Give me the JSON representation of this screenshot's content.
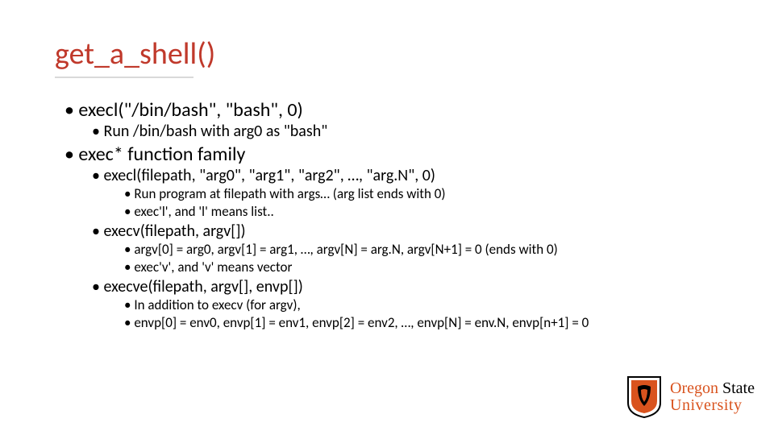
{
  "title": "get_a_shell()",
  "bullets": {
    "b1": "execl(\"/bin/bash\", \"bash\", 0)",
    "b1_1": "Run /bin/bash with arg0 as \"bash\"",
    "b2": "exec* function family",
    "b2_1": "execl(filepath, \"arg0\", \"arg1\", \"arg2\", …, \"arg.N\", 0)",
    "b2_1_1": "Run program at filepath with args… (arg list ends with 0)",
    "b2_1_2": "exec'l', and 'l' means list..",
    "b2_2": "execv(filepath, argv[])",
    "b2_2_1": "argv[0] = arg0, argv[1] = arg1, …, argv[N] = arg.N, argv[N+1] = 0 (ends with 0)",
    "b2_2_2": "exec'v', and 'v' means vector",
    "b2_3": "execve(filepath, argv[], envp[])",
    "b2_3_1": "In addition to execv (for argv),",
    "b2_3_2": "envp[0] = env0, envp[1] = env1, envp[2] = env2, …, envp[N] = env.N, envp[n+1] = 0"
  },
  "logo": {
    "line1a": "Oregon",
    "line1b": "State",
    "line2": "University"
  },
  "colors": {
    "title": "#c0392b",
    "accent": "#d9531e"
  }
}
